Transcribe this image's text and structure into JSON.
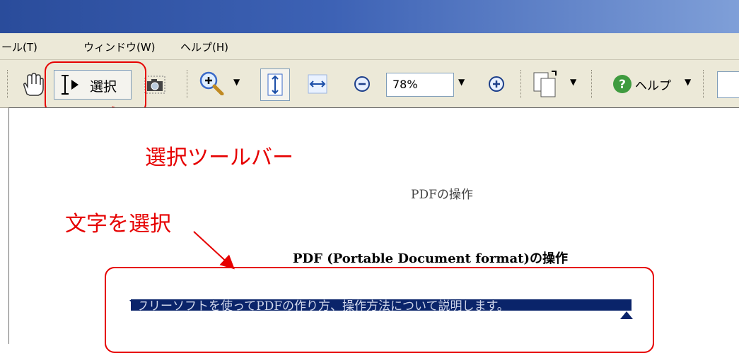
{
  "menu": {
    "items": [
      "ール(T)",
      "ウィンドウ(W)",
      "ヘルプ(H)"
    ]
  },
  "toolbar": {
    "select_label": "選択",
    "zoom_value": "78%",
    "help_label": "ヘルプ"
  },
  "document": {
    "page_title": "PDFの操作",
    "heading": "PDF (Portable Document format)の操作",
    "selected_text": "フリーソフトを使ってPDFの作り方、操作方法について説明します。"
  },
  "annotations": {
    "toolbar_label": "選択ツールバー",
    "text_select_label": "文字を選択"
  },
  "colors": {
    "annotation": "#e60000",
    "selection": "#0a246a",
    "titlebar": "#3d62b5"
  }
}
